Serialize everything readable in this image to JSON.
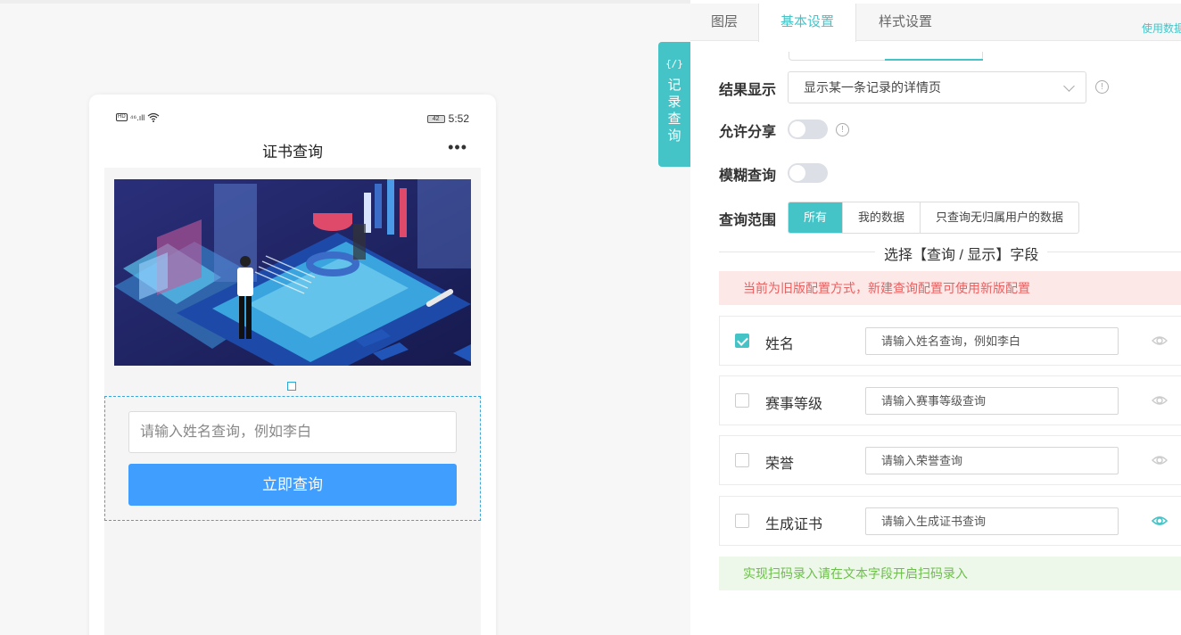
{
  "phone": {
    "status": {
      "network": "⁴⁶.ıll",
      "hd": "HD",
      "battery": "42",
      "time": "5:52"
    },
    "title": "证书查询",
    "more_icon": "more-dots-icon",
    "search_placeholder": "请输入姓名查询，例如李白",
    "search_button": "立即查询"
  },
  "side_tab": {
    "code": "{/}",
    "label": "记录查询"
  },
  "tabs": [
    {
      "label": "图层"
    },
    {
      "label": "基本设置"
    },
    {
      "label": "样式设置"
    }
  ],
  "tabs_link": "使用数据",
  "settings": {
    "result_display": {
      "label": "结果显示",
      "value": "显示某一条记录的详情页"
    },
    "allow_share": {
      "label": "允许分享",
      "on": false
    },
    "fuzzy_query": {
      "label": "模糊查询",
      "on": false
    },
    "query_scope": {
      "label": "查询范围",
      "options": [
        "所有",
        "我的数据",
        "只查询无归属用户的数据"
      ],
      "selected": "所有"
    }
  },
  "fields_title": "选择【查询 / 显示】字段",
  "warning": "当前为旧版配置方式，新建查询配置可使用新版配置",
  "fields": [
    {
      "name": "姓名",
      "placeholder": "请输入姓名查询，例如李白",
      "checked": true,
      "visible_icon": "eye-icon"
    },
    {
      "name": "赛事等级",
      "placeholder": "请输入赛事等级查询",
      "checked": false,
      "visible_icon": "eye-icon"
    },
    {
      "name": "荣誉",
      "placeholder": "请输入荣誉查询",
      "checked": false,
      "visible_icon": "eye-icon"
    },
    {
      "name": "生成证书",
      "placeholder": "请输入生成证书查询",
      "checked": false,
      "visible_icon": "eye-icon"
    }
  ],
  "tip": "实现扫码录入请在文本字段开启扫码录入",
  "colors": {
    "accent": "#45c4c8",
    "button": "#409eff",
    "warning": "#e96060",
    "success": "#6cc04a"
  }
}
